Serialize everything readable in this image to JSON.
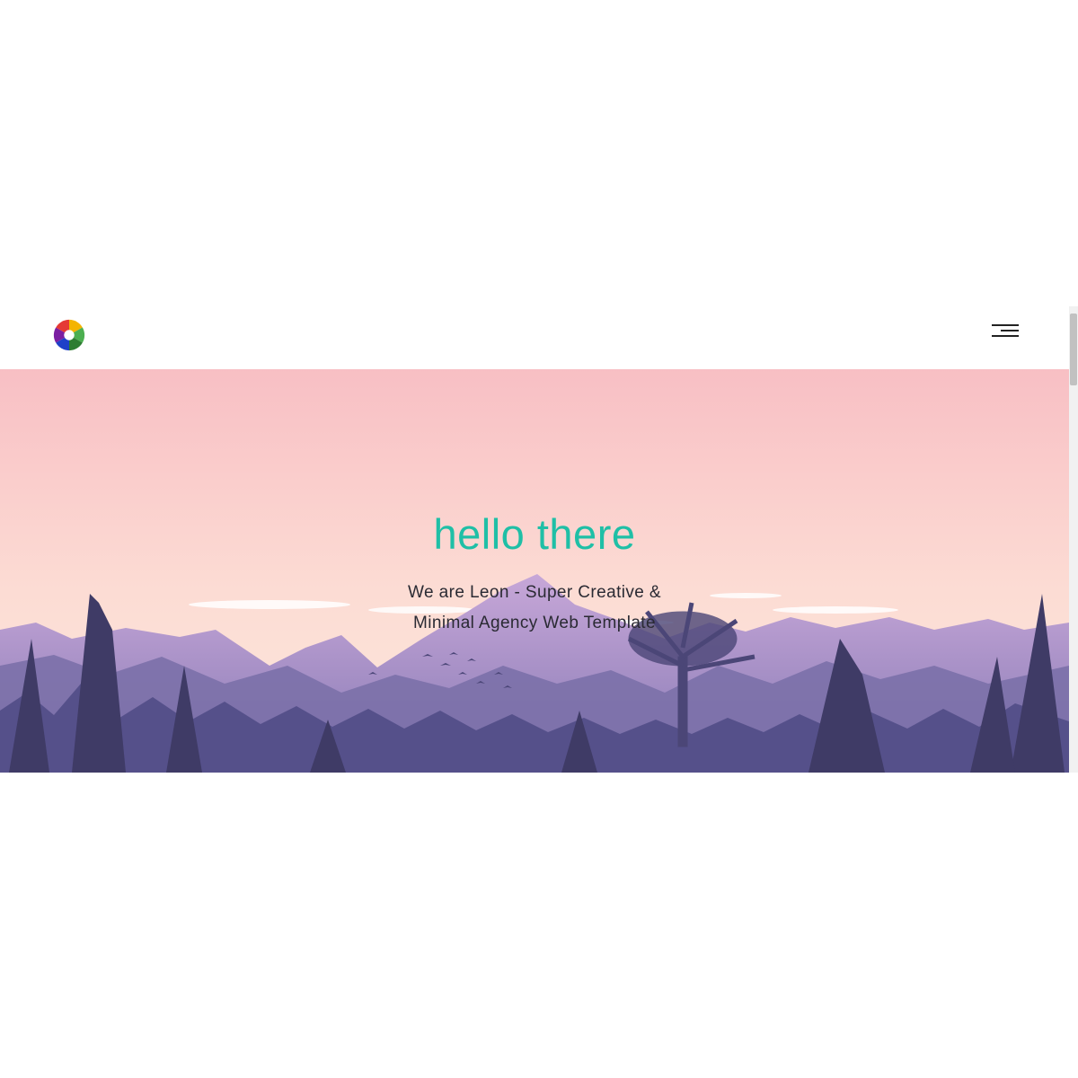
{
  "header": {
    "logo_name": "color-swirl-logo",
    "menu_icon": "hamburger-menu-icon"
  },
  "hero": {
    "title": "hello there",
    "subtitle_line1": "We are Leon - Super Creative &",
    "subtitle_line2": "Minimal Agency Web Template"
  },
  "colors": {
    "accent": "#1fbfa6",
    "sky_top": "#f9c1c3",
    "sky_bottom": "#fde3d8",
    "mountain": "#8a7fb6",
    "forest_dark": "#3d3a62"
  }
}
